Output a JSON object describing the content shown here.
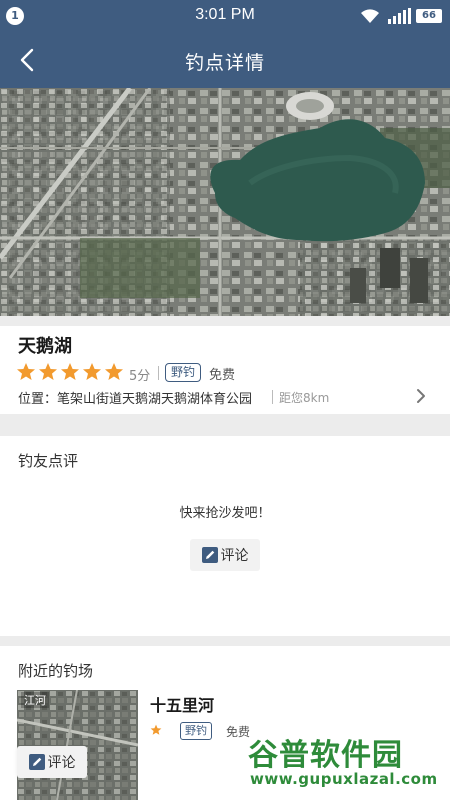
{
  "status_bar": {
    "notification_count": "1",
    "time": "3:01 PM",
    "battery": "66",
    "icons": [
      "wifi-icon",
      "signal-icon",
      "battery-icon"
    ]
  },
  "nav": {
    "title": "钓点详情",
    "back_icon": "back-chevron-icon"
  },
  "spot": {
    "name": "天鹅湖",
    "rating_stars": 5,
    "score": "5分",
    "tag": "野钓",
    "fee": "免费",
    "address": "位置：笔架山街道天鹅湖天鹅湖体育公园",
    "distance": "距您8km"
  },
  "reviews": {
    "title": "钓友点评",
    "empty_text": "快来抢沙发吧！",
    "comment_label": "评论"
  },
  "nearby": {
    "title": "附近的钓场",
    "items": [
      {
        "thumb_label": "江河",
        "name": "十五里河",
        "tag": "野钓",
        "fee": "免费"
      }
    ]
  },
  "floating": {
    "comment_label": "评论"
  },
  "watermark": {
    "main": "谷普软件园",
    "url": "www.gupuxlazal.com"
  },
  "colors": {
    "primary": "#3f5c80",
    "star": "#f29a2e",
    "watermark": "#2e8b3a"
  }
}
